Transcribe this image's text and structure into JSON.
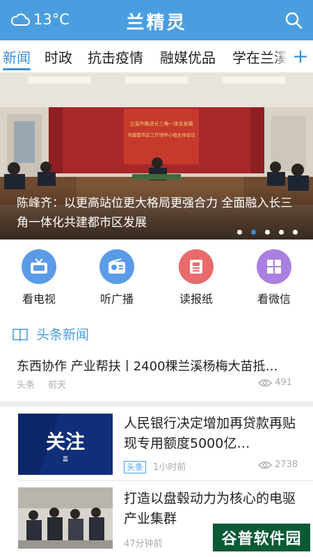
{
  "header": {
    "temperature": "13°C",
    "weather_icon": "cloud-icon",
    "title": "兰精灵",
    "search_icon": "search-icon",
    "bg_color": "#4a9ee0"
  },
  "tabs": {
    "items": [
      {
        "label": "新闻",
        "active": true
      },
      {
        "label": "时政",
        "active": false
      },
      {
        "label": "抗击疫情",
        "active": false
      },
      {
        "label": "融媒优品",
        "active": false
      },
      {
        "label": "学在兰溪",
        "active": false
      }
    ],
    "add_label": "+",
    "accent": "#3a8fd9"
  },
  "banner": {
    "title": "陈峰齐：以更高站位更大格局更强合力 全面融入长三角一体化共建都市区发展",
    "slide_count": 5,
    "active_slide": 2,
    "backdrop_text": [
      "兰溪市推进长三角一体化发展",
      "共建都市区工作领导小组全体会议"
    ]
  },
  "quick_links": [
    {
      "label": "看电视",
      "icon": "tv-icon",
      "color": "#5a9be8"
    },
    {
      "label": "听广播",
      "icon": "radio-icon",
      "color": "#5a9be8"
    },
    {
      "label": "读报纸",
      "icon": "newspaper-icon",
      "color": "#e96a6a"
    },
    {
      "label": "看微信",
      "icon": "wechat-grid-icon",
      "color": "#a97fe0"
    }
  ],
  "section": {
    "title": "头条新闻",
    "icon": "book-icon"
  },
  "headline": {
    "title": "东西协作 产业帮扶丨2400棵兰溪杨梅大苗抵…",
    "tag": "头条",
    "time": "前天",
    "views": "491"
  },
  "news": [
    {
      "title": "人民银行决定增加再贷款再贴现专用额度5000亿…",
      "tag": "头条",
      "time": "1小时前",
      "views": "2738",
      "thumb_text": "关注",
      "thumb_sub": "嘉"
    },
    {
      "title": "打造以盘毂动力为核心的电驱产业集群",
      "tag": "",
      "time": "47分钟前",
      "views": ""
    }
  ],
  "watermark": "谷普软件园"
}
